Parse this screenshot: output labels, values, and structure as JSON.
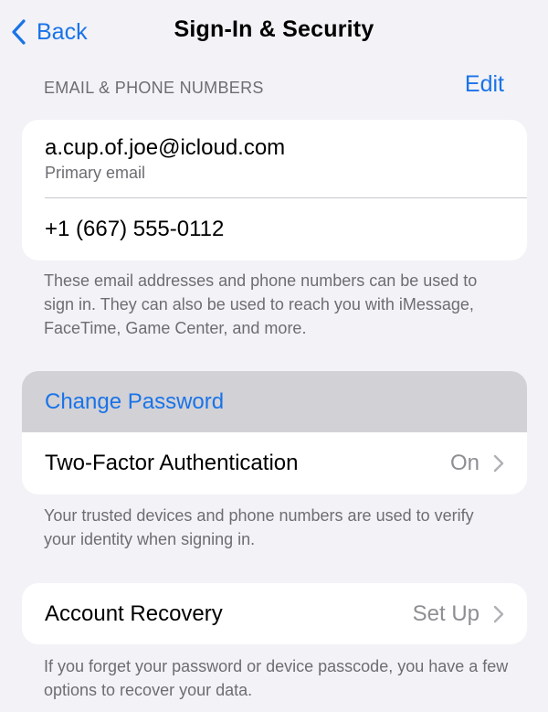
{
  "nav": {
    "back_label": "Back",
    "title": "Sign-In & Security"
  },
  "email_section": {
    "header": "EMAIL & PHONE NUMBERS",
    "edit_label": "Edit",
    "email": "a.cup.of.joe@icloud.com",
    "email_caption": "Primary email",
    "phone": "+1 (667) 555-0112",
    "footnote": "These email addresses and phone numbers can be used to sign in. They can also be used to reach you with iMessage, FaceTime, Game Center, and more."
  },
  "security_section": {
    "change_password": "Change Password",
    "two_factor_label": "Two-Factor Authentication",
    "two_factor_value": "On",
    "footnote": "Your trusted devices and phone numbers are used to verify your identity when signing in."
  },
  "recovery_section": {
    "label": "Account Recovery",
    "value": "Set Up",
    "footnote": "If you forget your password or device passcode, you have a few options to recover your data."
  },
  "colors": {
    "accent": "#1a73e8",
    "background": "#f2f2f7",
    "highlight": "#d1d1d6",
    "secondary_text": "#6d6d72"
  },
  "icons": [
    "chevron-left-icon",
    "chevron-right-icon"
  ]
}
